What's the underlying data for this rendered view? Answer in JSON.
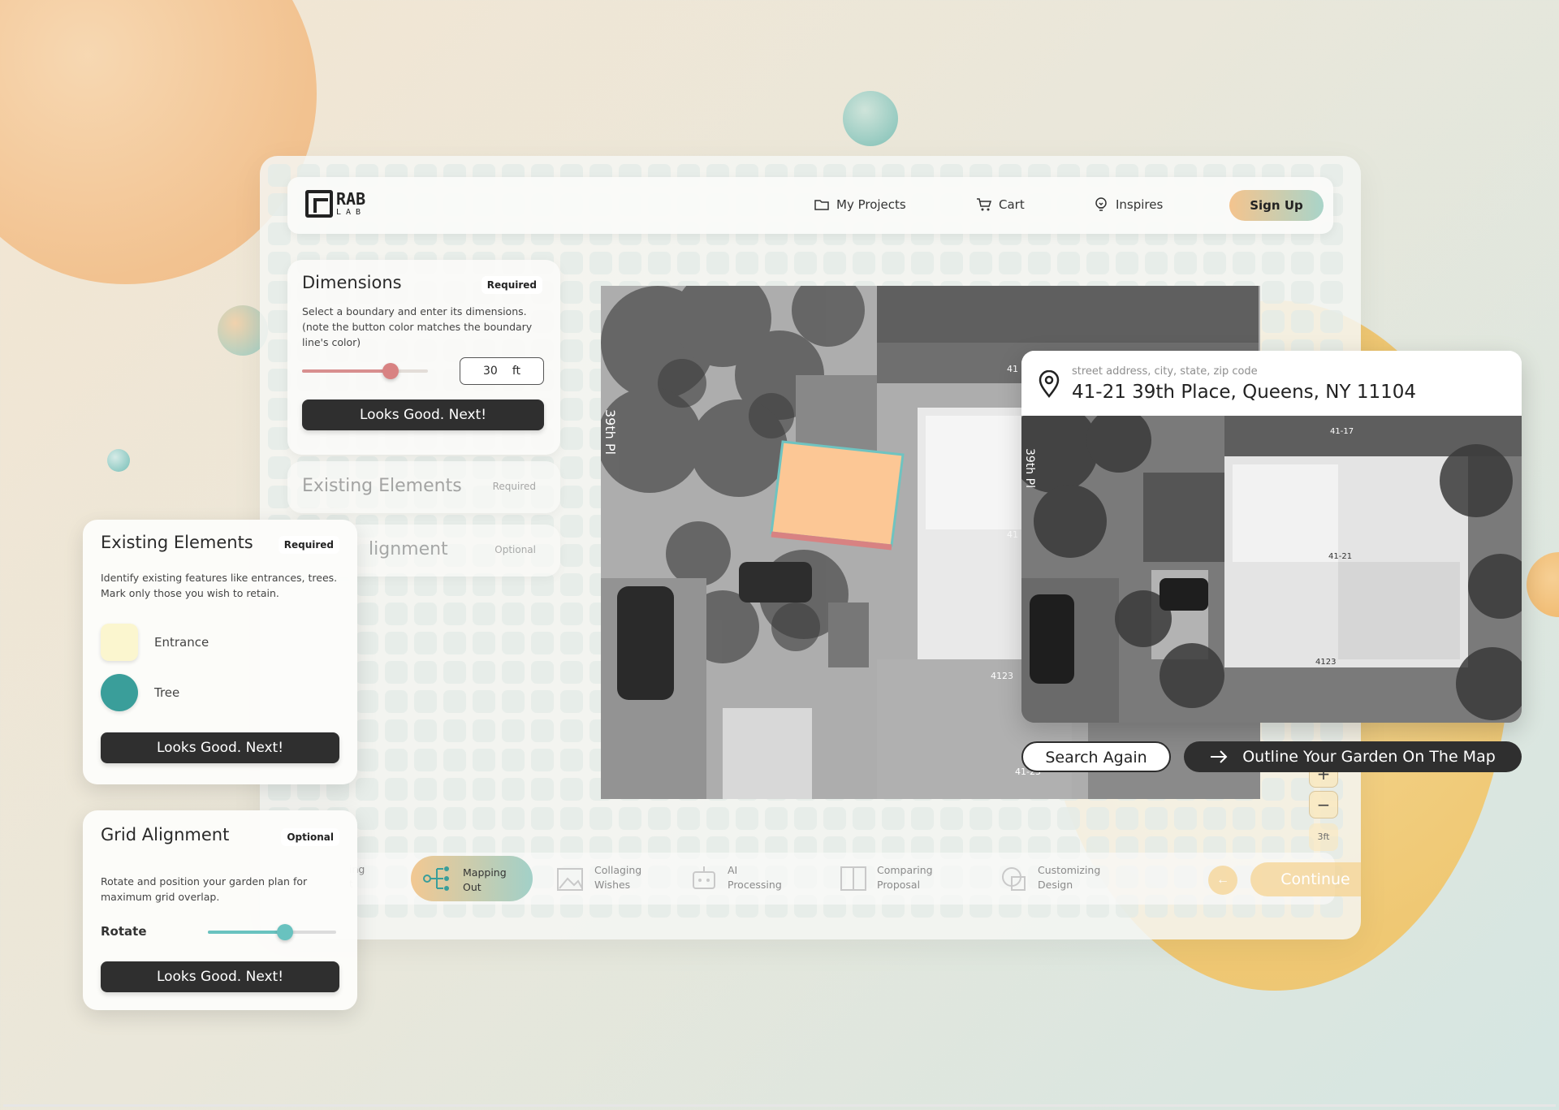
{
  "nav": {
    "logo_text": "RAB",
    "logo_sub": "LAB",
    "my_projects": "My Projects",
    "cart": "Cart",
    "inspires": "Inspires",
    "sign_up": "Sign Up",
    "icons": [
      "folder-icon",
      "cart-icon",
      "lightbulb-icon"
    ]
  },
  "dimensions_panel": {
    "title": "Dimensions",
    "badge": "Required",
    "description": "Select a boundary and enter its dimensions. (note the button color matches the boundary line's color)",
    "slider_value_fraction": 0.7,
    "input_value": "30",
    "input_unit": "ft",
    "button": "Looks Good. Next!",
    "slider_color": "#d88282"
  },
  "existing_collapsed": {
    "title": "Existing Elements",
    "badge": "Required"
  },
  "alignment_collapsed": {
    "title": "lignment",
    "badge": "Optional"
  },
  "existing_card": {
    "title": "Existing Elements",
    "badge": "Required",
    "description": "Identify existing features like entrances, trees. Mark only those you wish to retain.",
    "items": [
      {
        "label": "Entrance",
        "color": "#fbf6cf",
        "shape": "square"
      },
      {
        "label": "Tree",
        "color": "#3a9e9a",
        "shape": "circle"
      }
    ],
    "button": "Looks Good. Next!"
  },
  "grid_card": {
    "title": "Grid Alignment",
    "badge": "Optional",
    "description": "Rotate and position your garden plan for maximum grid overlap.",
    "rotate_label": "Rotate",
    "rotate_fraction": 0.6,
    "button": "Looks Good. Next!"
  },
  "map": {
    "street_label": "39th Pl",
    "house_numbers": [
      "41",
      "41",
      "4123",
      "41-25"
    ],
    "boundary_fill": "#fcc795",
    "boundary_stroke": "#6fc3c0"
  },
  "address_card": {
    "placeholder": "street address, city, state, zip code",
    "address": "41-21 39th Place, Queens, NY 11104",
    "map_labels": [
      "41-17",
      "41-21",
      "4123",
      "39th Pl"
    ]
  },
  "actions": {
    "search_again": "Search Again",
    "outline": "Outline Your Garden On The Map"
  },
  "zoom": {
    "minus": "−",
    "plus": "+",
    "scale": "3ft"
  },
  "progress": {
    "steps": [
      {
        "line1": "ing",
        "line2": "t"
      },
      {
        "line1": "Mapping",
        "line2": "Out",
        "active": true
      },
      {
        "line1": "Collaging",
        "line2": "Wishes"
      },
      {
        "line1": "AI",
        "line2": "Processing"
      },
      {
        "line1": "Comparing",
        "line2": "Proposal"
      },
      {
        "line1": "Customizing",
        "line2": "Design"
      }
    ],
    "back": "←",
    "continue": "Continue"
  }
}
